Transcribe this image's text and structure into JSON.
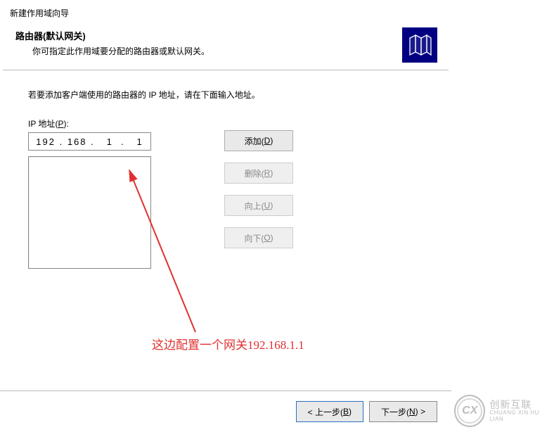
{
  "wizard": {
    "title": "新建作用域向导",
    "header_title": "路由器(默认网关)",
    "header_sub": "你可指定此作用域要分配的路由器或默认网关。",
    "instruction": "若要添加客户端使用的路由器的 IP 地址，请在下面输入地址。",
    "ip_label_prefix": "IP 地址(",
    "ip_label_key": "P",
    "ip_label_suffix": "):",
    "ip_value": "192 . 168 .   1  .   1",
    "buttons": {
      "add_prefix": "添加(",
      "add_key": "D",
      "add_suffix": ")",
      "remove_prefix": "删除(",
      "remove_key": "R",
      "remove_suffix": ")",
      "up_prefix": "向上(",
      "up_key": "U",
      "up_suffix": ")",
      "down_prefix": "向下(",
      "down_key": "O",
      "down_suffix": ")"
    },
    "nav": {
      "back_prefix": "< 上一步(",
      "back_key": "B",
      "back_suffix": ")",
      "next_prefix": "下一步(",
      "next_key": "N",
      "next_suffix": ") >"
    }
  },
  "annotation": {
    "text": "这边配置一个网关192.168.1.1"
  },
  "watermark": {
    "cn": "创新互联",
    "en": "CHUANG XIN HU LIAN",
    "logo": "CX"
  }
}
